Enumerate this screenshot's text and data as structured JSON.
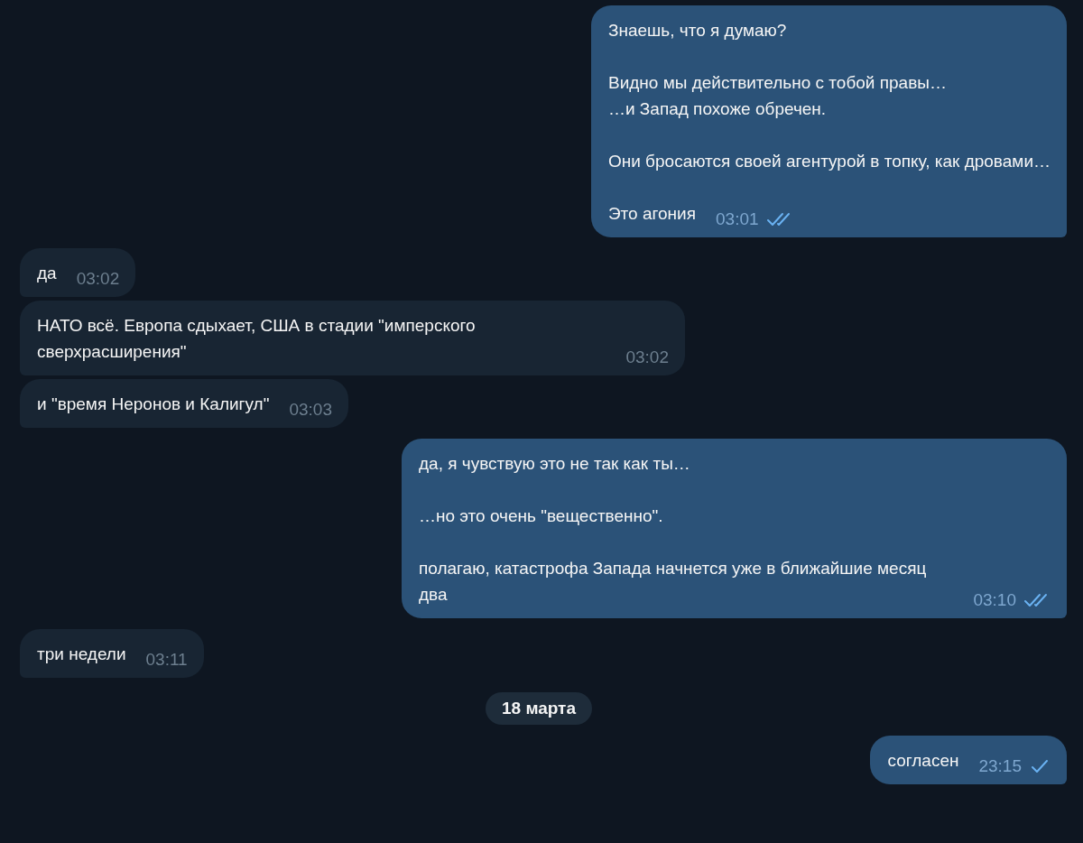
{
  "messages": [
    {
      "kind": "out",
      "paragraphs": [
        "Знаешь, что я думаю?",
        "Видно мы действительно с тобой правы…\n…и Запад похоже обречен.",
        "Они бросаются своей агентурой в топку, как дровами…",
        "Это агония"
      ],
      "time": "03:01",
      "read": true
    },
    {
      "kind": "in",
      "paragraphs": [
        "да"
      ],
      "time": "03:02"
    },
    {
      "kind": "in",
      "paragraphs": [
        "НАТО всё. Европа сдыхает, США в стадии \"имперского сверхрасширения\""
      ],
      "time": "03:02"
    },
    {
      "kind": "in",
      "paragraphs": [
        "и \"время Неронов и Калигул\""
      ],
      "time": "03:03"
    },
    {
      "kind": "out",
      "paragraphs": [
        "да, я чувствую это не так как ты…",
        "…но это очень \"вещественно\".",
        "полагаю, катастрофа Запада начнется уже в ближайшие месяц два"
      ],
      "time": "03:10",
      "read": true
    },
    {
      "kind": "in",
      "paragraphs": [
        "три недели"
      ],
      "time": "03:11"
    },
    {
      "kind": "date",
      "paragraphs": [
        "18 марта"
      ]
    },
    {
      "kind": "out",
      "paragraphs": [
        "согласен"
      ],
      "time": "23:15",
      "read": false
    }
  ]
}
